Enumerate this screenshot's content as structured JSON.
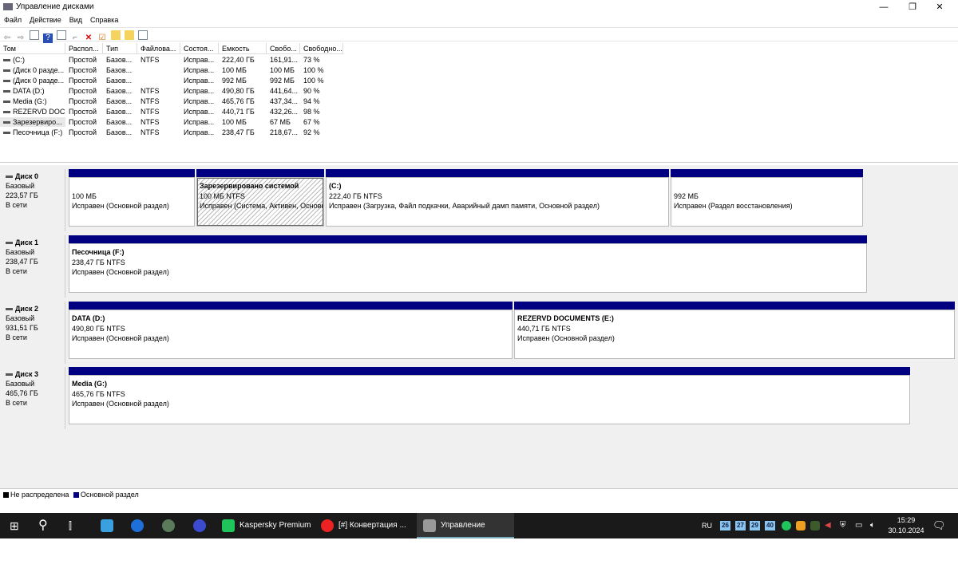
{
  "window": {
    "title": "Управление дисками",
    "minimize": "—",
    "maximize": "❐",
    "close": "✕"
  },
  "menu": [
    "Файл",
    "Действие",
    "Вид",
    "Справка"
  ],
  "toolbar": [
    "back-icon",
    "forward-icon",
    "console-tree-icon",
    "help-icon",
    "properties-icon",
    "connect-icon",
    "delete-icon",
    "check-icon",
    "folder-up-icon",
    "search-folder-icon",
    "view-icon"
  ],
  "columns": [
    "Том",
    "Распол...",
    "Тип",
    "Файлова...",
    "Состоя...",
    "Емкость",
    "Свобо...",
    "Свободно..."
  ],
  "volumes": [
    [
      "(C:)",
      "Простой",
      "Базов...",
      "NTFS",
      "Исправ...",
      "222,40 ГБ",
      "161,91...",
      "73 %"
    ],
    [
      "(Диск 0 разде...",
      "Простой",
      "Базов...",
      "",
      "Исправ...",
      "100 МБ",
      "100 МБ",
      "100 %"
    ],
    [
      "(Диск 0 разде...",
      "Простой",
      "Базов...",
      "",
      "Исправ...",
      "992 МБ",
      "992 МБ",
      "100 %"
    ],
    [
      "DATA (D:)",
      "Простой",
      "Базов...",
      "NTFS",
      "Исправ...",
      "490,80 ГБ",
      "441,64...",
      "90 %"
    ],
    [
      "Media (G:)",
      "Простой",
      "Базов...",
      "NTFS",
      "Исправ...",
      "465,76 ГБ",
      "437,34...",
      "94 %"
    ],
    [
      "REZERVD DOC...",
      "Простой",
      "Базов...",
      "NTFS",
      "Исправ...",
      "440,71 ГБ",
      "432,26...",
      "98 %"
    ],
    [
      "Зарезервиро...",
      "Простой",
      "Базов...",
      "NTFS",
      "Исправ...",
      "100 МБ",
      "67 МБ",
      "67 %"
    ],
    [
      "Песочница (F:)",
      "Простой",
      "Базов...",
      "NTFS",
      "Исправ...",
      "238,47 ГБ",
      "218,67...",
      "92 %"
    ]
  ],
  "disks": [
    {
      "name": "Диск 0",
      "type": "Базовый",
      "size": "223,57 ГБ",
      "status": "В сети",
      "partitions": [
        {
          "title": "",
          "size": "100 МБ",
          "status": "Исправен (Основной раздел)"
        },
        {
          "title": "Зарезервировано системой",
          "size": "100 МБ NTFS",
          "status": "Исправен (Система, Активен, Основной раздел)"
        },
        {
          "title": "(C:)",
          "size": "222,40 ГБ NTFS",
          "status": "Исправен (Загрузка, Файл подкачки, Аварийный дамп памяти, Основной раздел)"
        },
        {
          "title": "",
          "size": "992 МБ",
          "status": "Исправен (Раздел восстановления)"
        }
      ]
    },
    {
      "name": "Диск 1",
      "type": "Базовый",
      "size": "238,47 ГБ",
      "status": "В сети",
      "partitions": [
        {
          "title": "Песочница  (F:)",
          "size": "238,47 ГБ NTFS",
          "status": "Исправен (Основной раздел)"
        }
      ]
    },
    {
      "name": "Диск 2",
      "type": "Базовый",
      "size": "931,51 ГБ",
      "status": "В сети",
      "partitions": [
        {
          "title": "DATA  (D:)",
          "size": "490,80 ГБ NTFS",
          "status": "Исправен (Основной раздел)"
        },
        {
          "title": "REZERVD DOCUMENTS  (E:)",
          "size": "440,71 ГБ NTFS",
          "status": "Исправен (Основной раздел)"
        }
      ]
    },
    {
      "name": "Диск 3",
      "type": "Базовый",
      "size": "465,76 ГБ",
      "status": "В сети",
      "partitions": [
        {
          "title": "Media  (G:)",
          "size": "465,76 ГБ NTFS",
          "status": "Исправен (Основной раздел)"
        }
      ]
    }
  ],
  "legend": {
    "unallocated": "Не распределена",
    "primary": "Основной раздел",
    "unallocated_color": "#000000",
    "primary_color": "#000080"
  },
  "taskbar": {
    "apps": [
      {
        "label": "Kaspersky Premium"
      },
      {
        "label": "[#] Конвертация ..."
      },
      {
        "label": "Управление диска..."
      }
    ],
    "lang": "RU",
    "tray_numbers": [
      "26",
      "27",
      "29",
      "40"
    ],
    "time": "15:29",
    "date": "30.10.2024"
  }
}
